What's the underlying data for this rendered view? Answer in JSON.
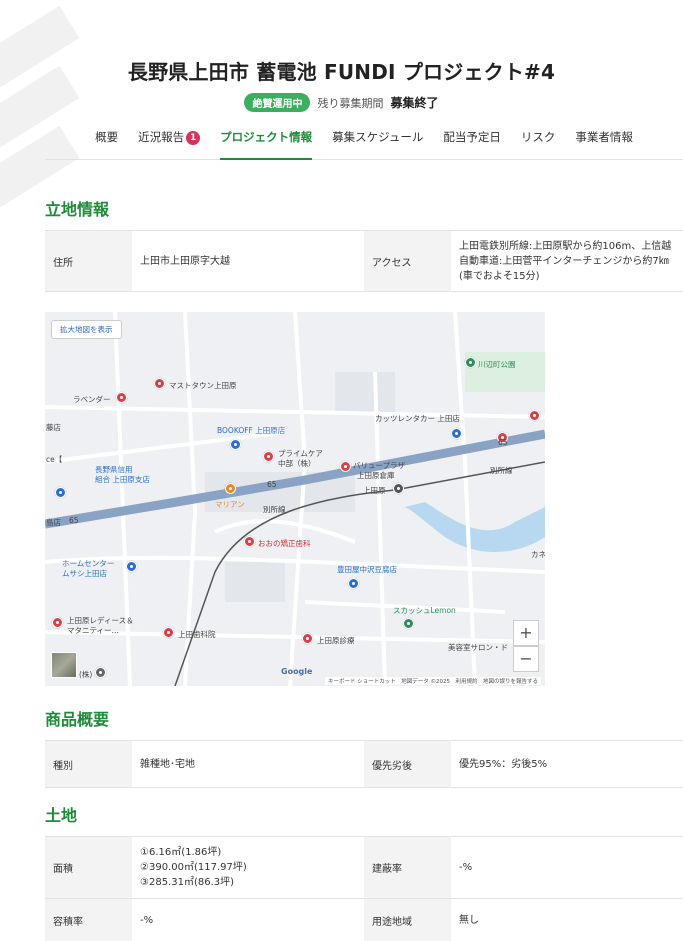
{
  "header": {
    "title": "長野県上田市 蓄電池 FUNDI プロジェクト#4",
    "status_badge": "絶賛運用中",
    "period_label": "残り募集期間",
    "period_value": "募集終了"
  },
  "tabs": [
    {
      "label": "概要",
      "active": false
    },
    {
      "label": "近況報告",
      "badge": "1",
      "active": false
    },
    {
      "label": "プロジェクト情報",
      "active": true
    },
    {
      "label": "募集スケジュール",
      "active": false
    },
    {
      "label": "配当予定日",
      "active": false
    },
    {
      "label": "リスク",
      "active": false
    },
    {
      "label": "事業者情報",
      "active": false
    }
  ],
  "location": {
    "title": "立地情報",
    "address_label": "住所",
    "address_value": "上田市上田原字大越",
    "access_label": "アクセス",
    "access_value": "上田電鉄別所線:上田原駅から約106m、上信越自動車道:上田菅平インターチェンジから約7㎞(車でおよそ15分)"
  },
  "map": {
    "expand_button": "拡大地図を表示",
    "zoom_in": "+",
    "zoom_out": "−",
    "google": "Google",
    "attribution": "キーボード ショートカット　地図データ ©2025　利用規約　地図の誤りを報告する",
    "labels": {
      "kawabe_park": "川辺町公園",
      "masutown": "マストタウン上田原",
      "lavender": "ラベンダー",
      "bookoff": "BOOKOFF 上田原店",
      "katsura": "カッツレンタカー 上田店",
      "prime": "プライムケア",
      "prime2": "中部（株）",
      "bank": "長野県信用",
      "bank2": "組合 上田原支店",
      "warehouse": "上田原倉庫",
      "station": "上田原",
      "marian": "マリアン",
      "bessho1": "別所線",
      "bessho2": "別所線",
      "route65a": "65",
      "route65b": "65",
      "route65c": "65",
      "ohno": "おおの矯正歯科",
      "homecenter": "ホームセンター",
      "homecenter2": "ムサシ上田店",
      "toyoda": "豊田屋中沢豆腐店",
      "sukasshu": "スカッシュLemon",
      "ladies": "上田原レディース＆",
      "ladies2": "マタニティー…",
      "dental": "上田歯科院",
      "hospital": "上田原診療",
      "salon": "美容室サロン・ド",
      "ka": "カネ",
      "kabu": "(株)",
      "left_edge1": "藤店",
      "left_edge2": "ce【",
      "left_edge3": "島店",
      "center_building": "バリュープラザ"
    }
  },
  "product": {
    "title": "商品概要",
    "type_label": "種別",
    "type_value": "雑種地･宅地",
    "priority_label": "優先劣後",
    "priority_value": "優先95%：劣後5%"
  },
  "land": {
    "title": "土地",
    "area_label": "面積",
    "area_lines": [
      "①6.16㎡(1.86坪)",
      "②390.00㎡(117.97坪)",
      "③285.31㎡(86.3坪)"
    ],
    "coverage_label": "建蔽率",
    "coverage_value": "-%",
    "far_label": "容積率",
    "far_value": "-%",
    "zoning_label": "用途地域",
    "zoning_value": "無し"
  },
  "colors": {
    "accent": "#1f8c3a",
    "badge_green": "#3dae5f",
    "badge_red": "#d6345b"
  }
}
